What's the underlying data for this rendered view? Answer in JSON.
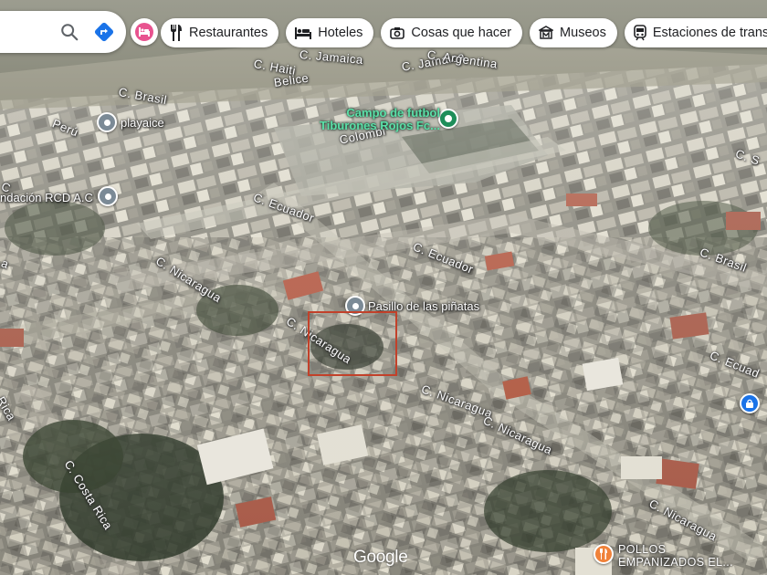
{
  "toolbar": {
    "search_icon": "search-icon",
    "directions_icon": "directions-icon",
    "hotel_icon": "hotel-icon",
    "chips": [
      {
        "label": "Restaurantes",
        "icon": "restaurant-icon"
      },
      {
        "label": "Hoteles",
        "icon": "bed-icon"
      },
      {
        "label": "Cosas que hacer",
        "icon": "camera-icon"
      },
      {
        "label": "Museos",
        "icon": "museum-icon"
      },
      {
        "label": "Estaciones de transp...",
        "icon": "train-icon"
      }
    ]
  },
  "map": {
    "streets": {
      "haiti": "C. Haiti",
      "jamaica1": "C. Jamaica",
      "jamaica2": "C. Jamaica",
      "argentina": "C. Argentina",
      "belice": "Belice",
      "brasil": "C. Brasil",
      "peru": "Perú",
      "colombia": "Colombi",
      "ecuador1": "C. Ecuador",
      "ecuador2": "C. Ecuador",
      "nicaragua1": "C. Nicaragua",
      "nicaragua2": "C. Nicaragua",
      "nicaragua3": "C. Nicaragua",
      "nicaragua4": "C. Nicaragua",
      "nicaragua5": "C. Nicaragua",
      "costa_rica": "C. Costa Rica",
      "rica": "Rica",
      "brasil_right": "C. Brasil",
      "ecuad_right": "C. Ecuad",
      "s_right": "C. S",
      "ca_left": "C",
      "a_left": "a"
    },
    "pois": {
      "playaice": "playaice",
      "fundacion": "ndación RCD A.C",
      "campo_line1": "Campo de futbol",
      "campo_line2": "Tiburones Rojos Fc...",
      "pasillo": "Pasillo de las piñatas",
      "pollos_line1": "POLLOS",
      "pollos_line2": "EMPANIZADOS EL..."
    },
    "logo": "Google",
    "colors": {
      "pin_gray": "#7b8a96",
      "pin_green": "#1e8e5a",
      "pin_blue": "#1a73e8",
      "pin_orange": "#f0823a",
      "selection": "#c2412a"
    }
  }
}
